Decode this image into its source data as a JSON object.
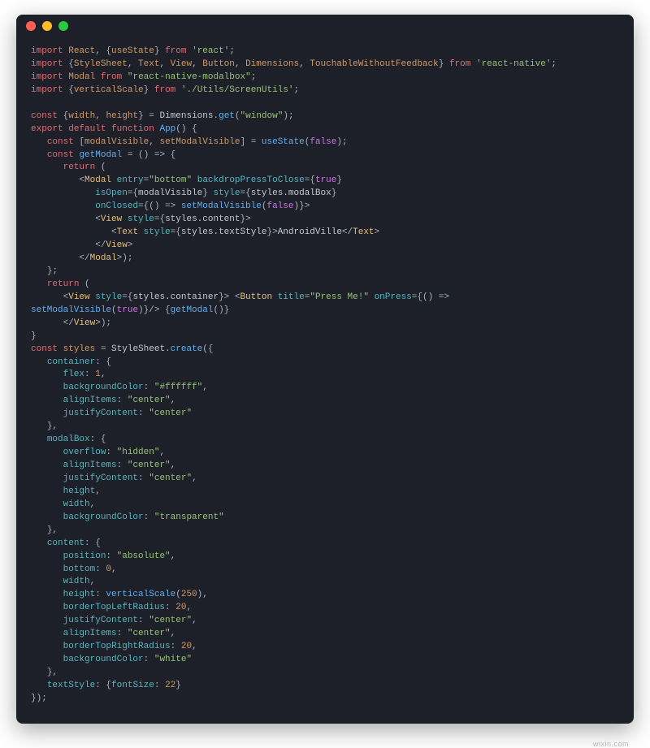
{
  "window": {
    "dots": [
      "close",
      "minimize",
      "zoom"
    ]
  },
  "code": {
    "imports": {
      "react_default": "React",
      "react_named": "useState",
      "react_module": "react",
      "rn_named": [
        "StyleSheet",
        "Text",
        "View",
        "Button",
        "Dimensions",
        "TouchableWithoutFeedback"
      ],
      "rn_module": "react-native",
      "modalbox_default": "Modal",
      "modalbox_module": "react-native-modalbox",
      "screenutils_named": "verticalScale",
      "screenutils_module": "./Utils/ScreenUtils"
    },
    "dims_destructure": [
      "width",
      "height"
    ],
    "dims_get_arg": "window",
    "component_name": "App",
    "state_var": "modalVisible",
    "state_setter": "setModalVisible",
    "state_initial": "false",
    "getModal_name": "getModal",
    "modal": {
      "entry": "bottom",
      "backdropPressToClose": "true",
      "isOpen_expr": "modalVisible",
      "style_expr": "styles.modalBox",
      "onClosed_arg": "false",
      "view_style": "styles.content",
      "text_style": "styles.textStyle",
      "text_content": "AndroidVille"
    },
    "main": {
      "container_style": "styles.container",
      "button_title": "Press Me!",
      "onPress_arg": "true",
      "getModal_call": "getModal"
    },
    "styles_const": "styles",
    "styles": {
      "container": {
        "flex": "1",
        "backgroundColor": "#ffffff",
        "alignItems": "center",
        "justifyContent": "center"
      },
      "modalBox": {
        "overflow": "hidden",
        "alignItems": "center",
        "justifyContent": "center",
        "height": "height",
        "width": "width",
        "backgroundColor": "transparent"
      },
      "content": {
        "position": "absolute",
        "bottom": "0",
        "width": "width",
        "height_vs_arg": "250",
        "borderTopLeftRadius": "20",
        "justifyContent": "center",
        "alignItems": "center",
        "borderTopRightRadius": "20",
        "backgroundColor": "white"
      },
      "textStyle": {
        "fontSize": "22"
      }
    }
  },
  "watermark": "wixin.com"
}
